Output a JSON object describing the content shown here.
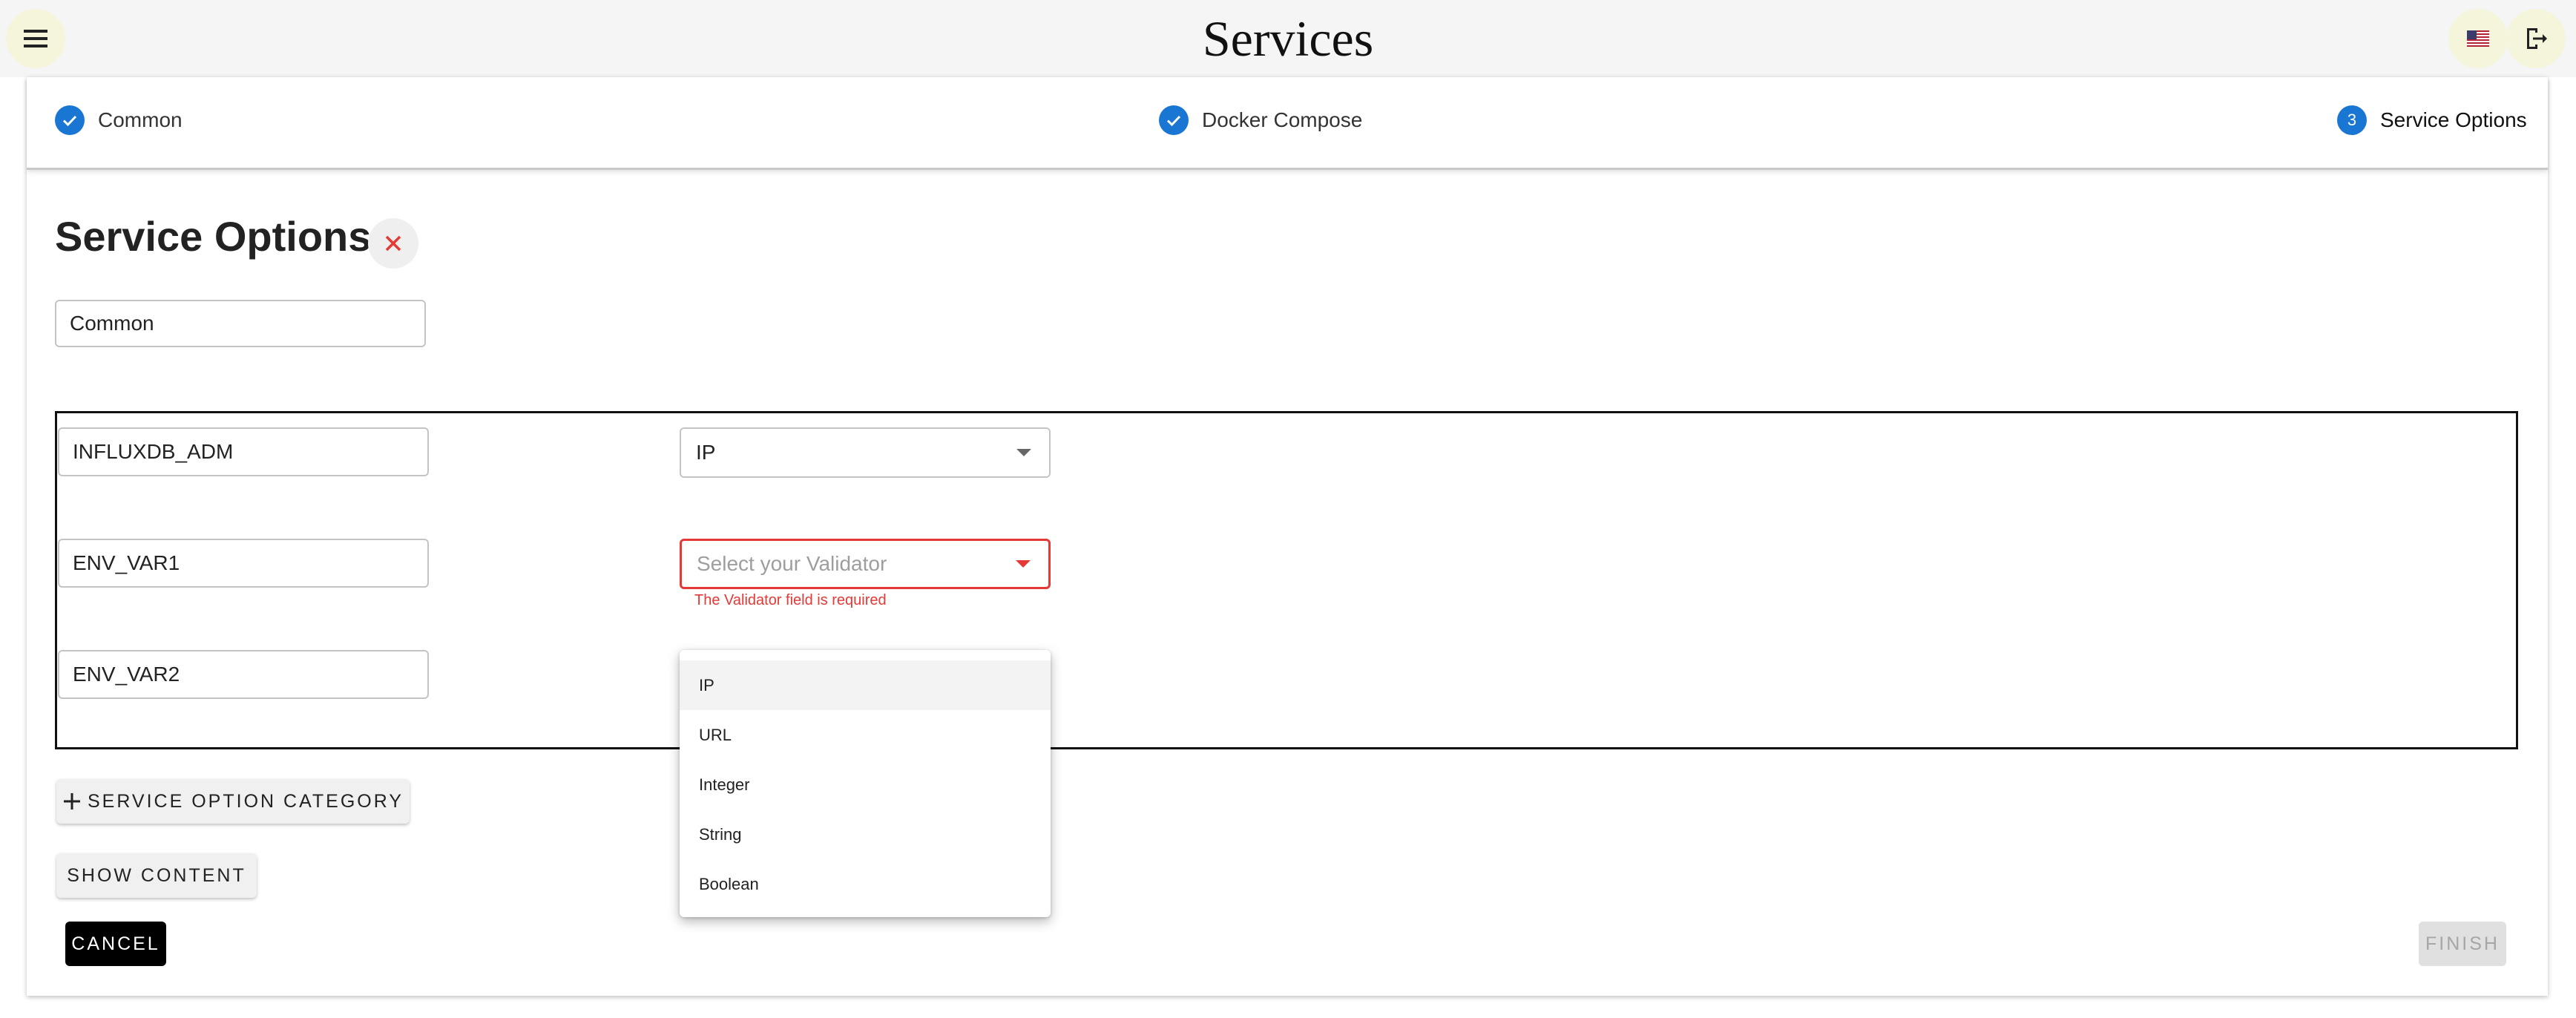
{
  "app": {
    "title": "Services"
  },
  "header": {
    "menu_icon": "hamburger-menu-icon",
    "flag_icon": "us-flag-icon",
    "logout_icon": "logout-icon"
  },
  "stepper": {
    "steps": [
      {
        "label": "Common",
        "state": "completed"
      },
      {
        "label": "Docker Compose",
        "state": "completed"
      },
      {
        "label": "Service Options",
        "number": "3",
        "state": "active"
      }
    ]
  },
  "section": {
    "title": "Service Options",
    "category_value": "Common"
  },
  "options": [
    {
      "name": "INFLUXDB_ADM",
      "validator": "IP"
    },
    {
      "name": "ENV_VAR1",
      "validator": "",
      "placeholder": "Select your Validator",
      "error": "The Validator field is required"
    },
    {
      "name": "ENV_VAR2"
    }
  ],
  "dropdown": {
    "items": [
      "IP",
      "URL",
      "Integer",
      "String",
      "Boolean"
    ],
    "highlighted": "IP"
  },
  "buttons": {
    "add_category": "Service option category",
    "show_content": "Show content",
    "cancel": "Cancel",
    "finish": "Finish"
  },
  "colors": {
    "primary": "#1976d2",
    "error": "#e53935",
    "header_bg": "#f5f5f5"
  }
}
